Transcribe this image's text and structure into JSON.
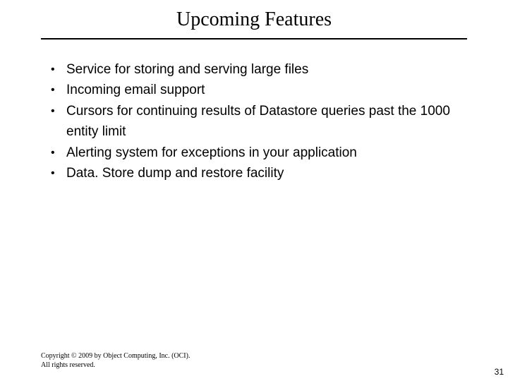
{
  "slide": {
    "title": "Upcoming Features",
    "bullets": [
      "Service for storing and serving large files",
      "Incoming email support",
      "Cursors for continuing results of Datastore queries past the 1000 entity limit",
      "Alerting system for exceptions in your application",
      "Data. Store dump and restore facility"
    ],
    "footer_line1": "Copyright © 2009 by Object Computing, Inc. (OCI).",
    "footer_line2": "All rights reserved.",
    "page_number": "31"
  }
}
